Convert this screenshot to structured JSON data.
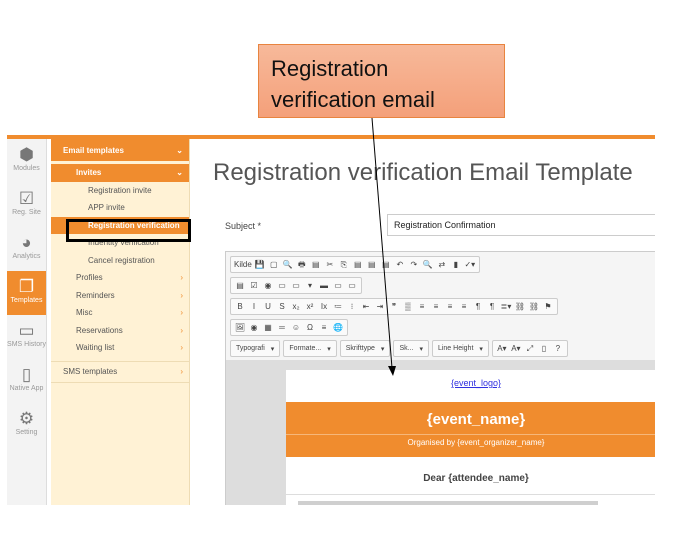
{
  "callout": {
    "text": "Registration verification email"
  },
  "modules": [
    {
      "label": "Modules",
      "icon": "cube-icon",
      "glyph": "⬢"
    },
    {
      "label": "Reg. Site",
      "icon": "checkbox-icon",
      "glyph": "☑"
    },
    {
      "label": "Analytics",
      "icon": "pie-chart-icon",
      "glyph": "◕"
    },
    {
      "label": "Templates",
      "icon": "documents-icon",
      "glyph": "❐",
      "active": true
    },
    {
      "label": "SMS History",
      "icon": "chat-icon",
      "glyph": "▭"
    },
    {
      "label": "Native App",
      "icon": "phone-icon",
      "glyph": "▯"
    },
    {
      "label": "Setting",
      "icon": "gears-icon",
      "glyph": "⚙"
    }
  ],
  "submenu": {
    "email_templates": "Email templates",
    "invites": "Invites",
    "invite_items": [
      "Registration invite",
      "APP invite",
      "Registration verification",
      "Indentity verification",
      "Cancel registration"
    ],
    "groups": [
      "Profiles",
      "Reminders",
      "Misc",
      "Reservations",
      "Waiting list"
    ],
    "sms_templates": "SMS templates"
  },
  "main": {
    "title": "Registration verification Email Template",
    "subject_label": "Subject *",
    "subject_value": "Registration Confirmation"
  },
  "toolbar": {
    "source": "Kilde",
    "row1": [
      "💾",
      "▢",
      "🔍",
      "🖶",
      "▤",
      "✂",
      "⎘",
      "▤",
      "▤",
      "▤",
      "↶",
      "↷",
      "🔍",
      "⇄",
      "▮",
      "✓▾"
    ],
    "row2": [
      "▤",
      "☑",
      "◉",
      "▭",
      "▭",
      "▾",
      "▬",
      "▭",
      "▭"
    ],
    "row3": [
      "B",
      "I",
      "U",
      "S",
      "x₂",
      "x²",
      "Ix",
      "≔",
      "⁝",
      "⇤",
      "⇥",
      "❞",
      "▒",
      "≡",
      "≡",
      "≡",
      "≡",
      "¶",
      "¶",
      "≣▾",
      "⛓",
      "⛓",
      "⚑"
    ],
    "row4": [
      "🖼",
      "◉",
      "▦",
      "═",
      "☺",
      "Ω",
      "≡",
      "🌐"
    ],
    "dropdowns": [
      "Typografi",
      "Formate...",
      "Skrifttype",
      "Sk...",
      "Line Height"
    ],
    "extra": [
      "A▾",
      "A▾",
      "⤢",
      "▯",
      "?"
    ]
  },
  "email": {
    "logo": "{event_logo}",
    "event_name": "{event_name}",
    "organised_by": "Organised by {event_organizer_name}",
    "dear": "Dear {attendee_name}"
  },
  "colors": {
    "accent": "#f08c2e",
    "submenu_bg": "#fff2d5",
    "callout": "#f4a07a"
  }
}
